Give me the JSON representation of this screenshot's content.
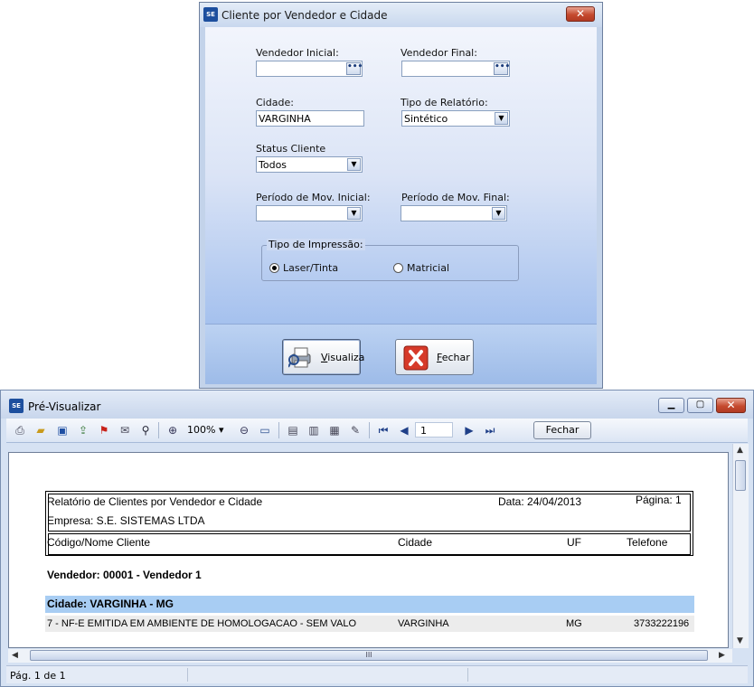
{
  "dialog": {
    "title": "Cliente por Vendedor e Cidade",
    "logo_text": "SE",
    "close_glyph": "✕",
    "vendedor_inicial": {
      "label": "Vendedor Inicial:",
      "value": "",
      "lookup_glyph": "•••"
    },
    "vendedor_final": {
      "label": "Vendedor Final:",
      "value": "",
      "lookup_glyph": "•••"
    },
    "cidade": {
      "label": "Cidade:",
      "value": "VARGINHA"
    },
    "tipo_relatorio": {
      "label": "Tipo de Relatório:",
      "value": "Sintético"
    },
    "status_cliente": {
      "label": "Status Cliente",
      "value": "Todos"
    },
    "periodo_inicial": {
      "label": "Período de Mov. Inicial:",
      "value": ""
    },
    "periodo_final": {
      "label": "Período de Mov. Final:",
      "value": ""
    },
    "tipo_impressao": {
      "label": "Tipo de Impressão:",
      "options": [
        {
          "label": "Laser/Tinta",
          "selected": true
        },
        {
          "label": "Matricial",
          "selected": false
        }
      ]
    },
    "visualiza_button": {
      "mnemonic": "V",
      "rest": "isualiza"
    },
    "fechar_button": {
      "mnemonic": "F",
      "rest": "echar"
    }
  },
  "preview": {
    "title": "Pré-Visualizar",
    "logo_text": "SE",
    "window_buttons": {
      "minimize": "▁",
      "maximize": "▢",
      "close": "✕"
    },
    "toolbar": {
      "zoom": "100%",
      "page": "1",
      "fechar_label": "Fechar",
      "icons": [
        "print-icon",
        "open-icon",
        "save-icon",
        "export-icon",
        "pdf-icon",
        "send-icon",
        "find-icon",
        "zoom-in-icon",
        "zoom-out-icon",
        "fit-page-icon",
        "single-page-icon",
        "multi-page-icon",
        "book-icon",
        "edit-icon",
        "first-page-icon",
        "prev-page-icon",
        "next-page-icon",
        "last-page-icon"
      ]
    },
    "report": {
      "title": "Relatório de Clientes por Vendedor e Cidade",
      "date": "Data: 24/04/2013",
      "page": "Página: 1",
      "company": "Empresa: S.E. SISTEMAS LTDA",
      "columns": [
        "Código/Nome Cliente",
        "Cidade",
        "UF",
        "Telefone"
      ],
      "vendedor": "Vendedor: 00001 - Vendedor 1",
      "cidade_band": "Cidade: VARGINHA - MG",
      "rows": [
        {
          "cliente": "7 - NF-E EMITIDA EM AMBIENTE DE HOMOLOGACAO - SEM VALO",
          "cidade": "VARGINHA",
          "uf": "MG",
          "telefone": "3733222196"
        }
      ]
    },
    "status": {
      "page_info": "Pág. 1 de 1"
    },
    "scroll_grip": "III"
  },
  "colors": {
    "dialog_body": "#c3d3ea",
    "band": "#a8cdf3",
    "close": "#c54a2f"
  }
}
